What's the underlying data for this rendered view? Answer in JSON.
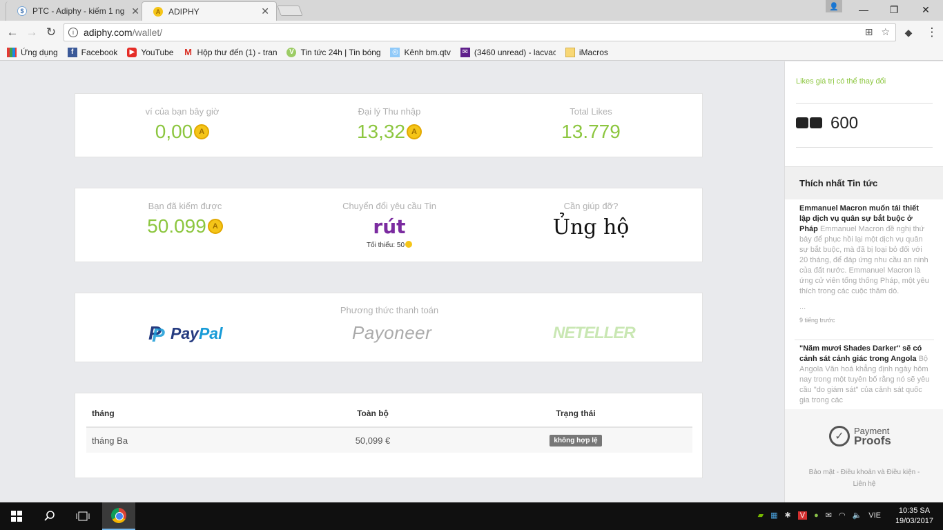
{
  "browser": {
    "tabs": [
      {
        "title": "PTC - Adiphy - kiếm 1 ng",
        "active": false
      },
      {
        "title": "ADIPHY",
        "active": true
      }
    ],
    "url_host": "adiphy.com",
    "url_path": "/wallet/",
    "bookmarks": [
      {
        "label": "Ứng dụng",
        "icon": "apps-grid-icon"
      },
      {
        "label": "Facebook",
        "icon": "facebook-icon"
      },
      {
        "label": "YouTube",
        "icon": "youtube-icon"
      },
      {
        "label": "Hộp thư đến (1) - tran",
        "icon": "gmail-icon"
      },
      {
        "label": "Tin tức 24h | Tin bóng",
        "icon": "news-icon"
      },
      {
        "label": "Kênh bm.qtv",
        "icon": "globe-icon"
      },
      {
        "label": "(3460 unread) - lacvac",
        "icon": "mail-icon"
      },
      {
        "label": "iMacros",
        "icon": "folder-icon"
      }
    ]
  },
  "wallet": {
    "current_label": "ví của bạn bây giờ",
    "current_value": "0,00",
    "agent_label": "Đại lý Thu nhập",
    "agent_value": "13,32",
    "likes_label": "Total Likes",
    "likes_value": "13.779",
    "earned_label": "Bạn đã kiếm được",
    "earned_value": "50.099",
    "convert_label": "Chuyển đổi yêu cầu Tin",
    "convert_action": "rút",
    "minimum_label": "Tối thiểu: 50",
    "help_label": "Cần giúp đỡ?",
    "help_action": "Ủng hộ"
  },
  "payment": {
    "title": "Phương thức thanh toán",
    "methods": [
      "PayPal",
      "Payoneer",
      "NETELLER"
    ]
  },
  "table": {
    "headers": [
      "tháng",
      "Toàn bộ",
      "Trạng thái"
    ],
    "rows": [
      {
        "month": "tháng Ba",
        "total": "50,099 €",
        "status": "không hợp lệ"
      }
    ]
  },
  "sidebar": {
    "note": "Likes giá trị có thể thay đổi",
    "likes_count": "600",
    "news_heading": "Thích nhất Tin tức",
    "news": [
      {
        "headline": "Emmanuel Macron muốn tái thiết lập dịch vụ quân sự bắt buộc ở Pháp",
        "body": "Emmanuel Macron đề nghị thứ bảy để phục hồi lại một dịch vụ quân sự bắt buộc, mà đã bị loại bỏ đối với 20 tháng, để đáp ứng nhu cầu an ninh của đất nước. Emmanuel Macron là ứng cử viên tổng thống Pháp, một yêu thích trong các cuộc thăm dò.",
        "more": "...",
        "time": "9 tiếng trước"
      },
      {
        "headline": "\"Năm mươi Shades Darker\" sẽ có cảnh sát cảnh giác trong Angola",
        "body": "Bộ Angola Văn hoá khẳng định ngày hôm nay trong một tuyên bố rằng nó sẽ yêu cầu \"do giám sát\" của cảnh sát quốc gia trong các"
      }
    ],
    "payment_proofs_1": "Payment",
    "payment_proofs_2": "Proofs",
    "footer_line1": "Bảo mật - Điều khoản và Điều kiện -",
    "footer_line2": "Liên hệ"
  },
  "taskbar": {
    "language": "VIE",
    "time": "10:35 SA",
    "date": "19/03/2017"
  },
  "colors": {
    "green": "#8cc63f",
    "purple": "#7b2ba0",
    "coin": "#f5c518",
    "paypal_dark": "#253b80",
    "paypal_light": "#179bd7"
  }
}
